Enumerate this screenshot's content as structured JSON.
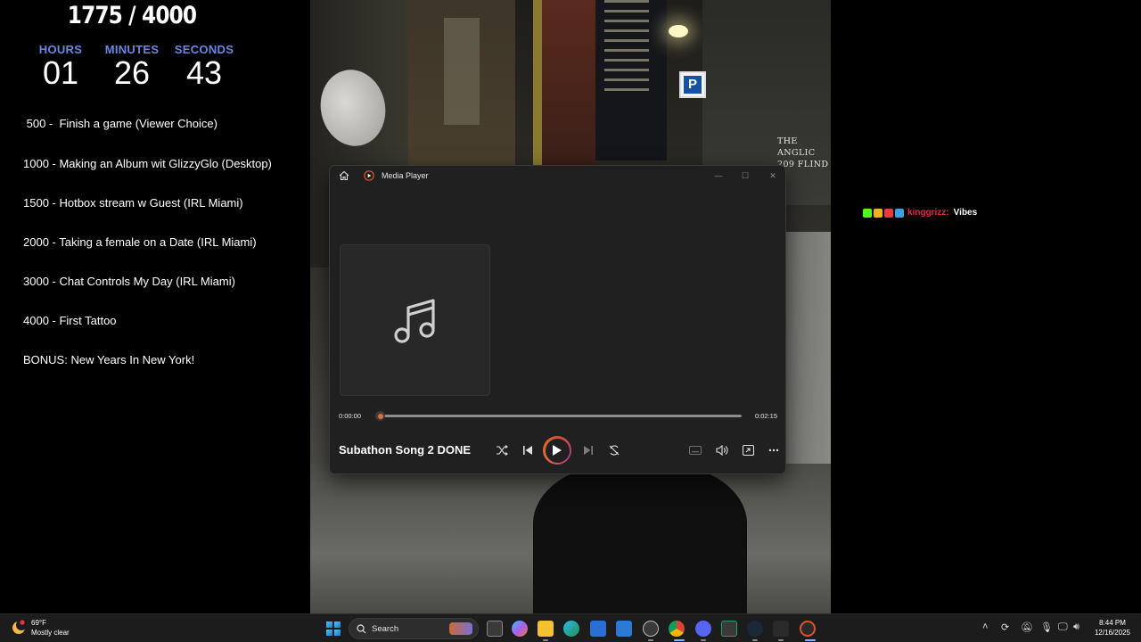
{
  "overlay": {
    "goal_count": "1775 / 4000",
    "timer": {
      "hours_label": "HOURS",
      "hours": "01",
      "minutes_label": "MINUTES",
      "minutes": "26",
      "seconds_label": "SECONDS",
      "seconds": "43"
    },
    "goals": [
      " 500 -  Finish a game (Viewer Choice)",
      "1000 - Making an Album wit GlizzyGlo (Desktop)",
      "1500 - Hotbox stream w Guest (IRL Miami)",
      "2000 - Taking a female on a Date (IRL Miami)",
      "3000 - Chat Controls My Day (IRL Miami)",
      "4000 - First Tattoo",
      "BONUS: New Years In New York!"
    ]
  },
  "photo": {
    "sign_line1": "THE ANGLIC",
    "sign_line2": "209 FLIND",
    "parking_letter": "P"
  },
  "media_player": {
    "title": "Media Player",
    "current_time": "0:00:00",
    "total_time": "0:02:15",
    "progress_fraction": 0.0,
    "song_title": "Subathon Song 2 DONE",
    "accent_color": "#e25a2c",
    "icons": [
      "home-icon",
      "media-player-icon",
      "minimize-icon",
      "maximize-icon",
      "close-icon",
      "music-note-icon",
      "shuffle-icon",
      "previous-icon",
      "play-icon",
      "next-icon",
      "repeat-icon",
      "captions-icon",
      "volume-icon",
      "mini-player-icon",
      "more-icon"
    ]
  },
  "chat": {
    "username": "kinggrizz:",
    "message": "Vibes",
    "username_color": "#e0264b"
  },
  "taskbar": {
    "weather_temp": "69°F",
    "weather_desc": "Mostly clear",
    "search_label": "Search",
    "time": "8:44 PM",
    "date": "12/16/2025"
  }
}
